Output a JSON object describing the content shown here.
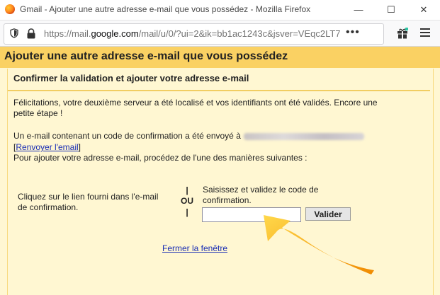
{
  "browser": {
    "window_title": "Gmail - Ajouter une autre adresse e-mail que vous possédez - Mozilla Firefox",
    "url_prefix": "https://mail.",
    "url_domain": "google.com",
    "url_rest": "/mail/u/0/?ui=2&ik=bb1ac1243c&jsver=VEqc2LT7",
    "overflow_dots": "•••",
    "minimize_symbol": "—",
    "maximize_symbol": "☐",
    "close_symbol": "✕"
  },
  "dialog": {
    "title": "Ajouter une autre adresse e-mail que vous possédez",
    "subtitle": "Confirmer la validation et ajouter votre adresse e-mail",
    "congrats_line1": "Félicitations, votre deuxième serveur a été localisé et vos identifiants ont été validés. Encore une",
    "congrats_line2": "petite étape !",
    "sent_text": "Un e-mail contenant un code de confirmation a été envoyé à",
    "bracket_open": "[",
    "resend_link": "Renvoyer l'email",
    "bracket_close": "]",
    "instruction": "Pour ajouter votre adresse e-mail, procédez de l'une des manières suivantes :",
    "option_link_line1": "Cliquez sur le lien fourni dans l'e-mail",
    "option_link_line2": "de confirmation.",
    "or_bar_top": "|",
    "or_label": "OU",
    "or_bar_bottom": "|",
    "option_code_line1": "Saisissez et validez le code de",
    "option_code_line2": "confirmation.",
    "code_value": "",
    "validate_button": "Valider",
    "close_link": "Fermer la fenêtre"
  },
  "colors": {
    "header_bg": "#fad163",
    "panel_bg": "#fff7d2",
    "link": "#1b2fb4",
    "arrow": "#f5a623"
  },
  "icons": [
    "firefox-icon",
    "shield-icon",
    "lock-icon",
    "gift-icon",
    "hamburger-menu-icon",
    "annotation-arrow-icon"
  ]
}
